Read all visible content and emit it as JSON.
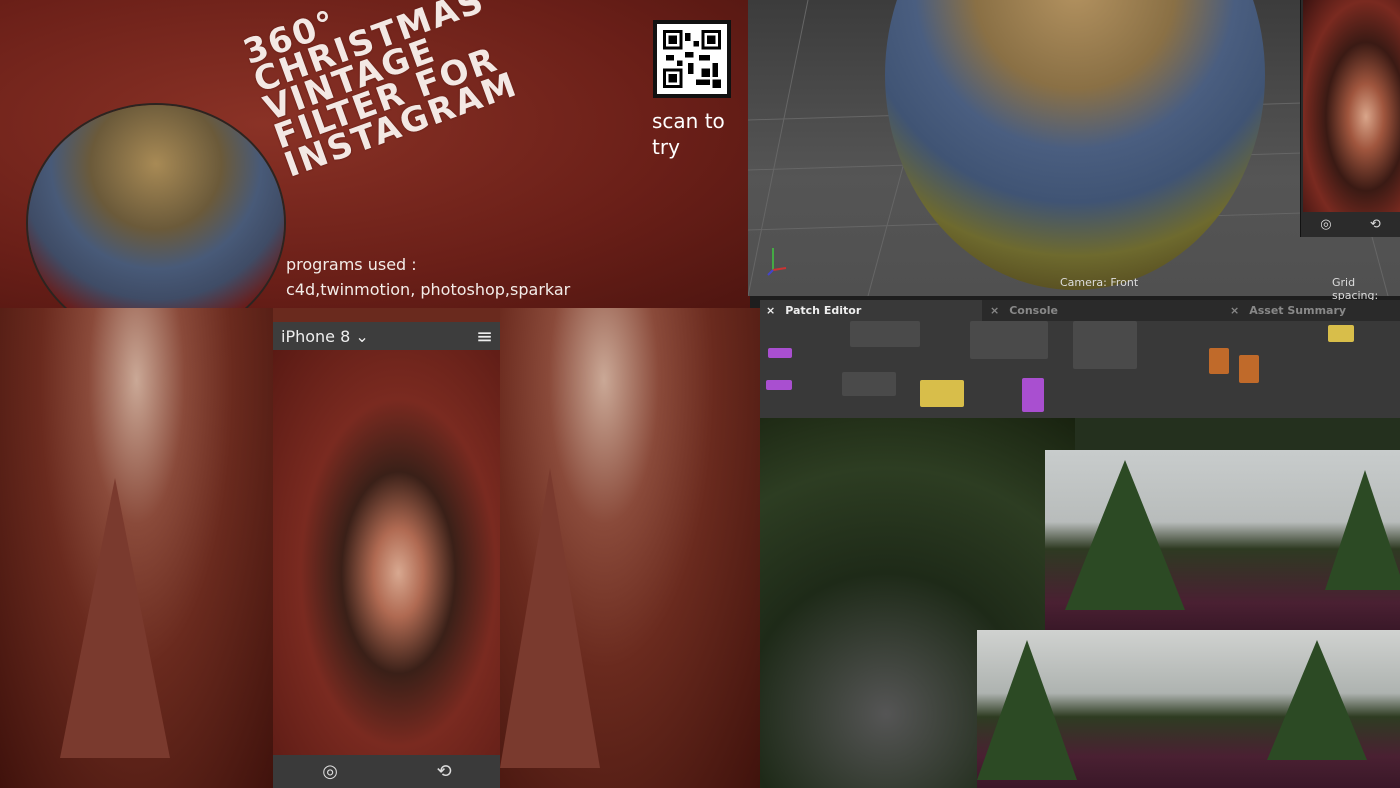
{
  "poster": {
    "title_lines": [
      "360°",
      "CHRISTMAS",
      "VINTAGE",
      "FILTER FOR",
      "INSTAGRAM"
    ],
    "programs_label": "programs used :",
    "programs_list": "c4d,twinmotion, photoshop,sparkar",
    "scan_text": "scan to try"
  },
  "viewport": {
    "camera_label": "Camera: Front",
    "grid_label": "Grid spacing:"
  },
  "patch_editor": {
    "tabs": [
      {
        "label": "Patch Editor",
        "active": true
      },
      {
        "label": "Console",
        "active": false
      },
      {
        "label": "Asset Summary",
        "active": false
      }
    ],
    "close_glyph": "×"
  },
  "phone": {
    "device_label": "iPhone 8",
    "chevron": "⌄",
    "menu": "≡",
    "flip_icon": "⟲",
    "camera_icon": "◎"
  },
  "colors": {
    "poster_bg": "#6a1f18",
    "patch_purple": "#a94fd0",
    "patch_orange": "#c06a2a",
    "patch_yellow": "#d8be4a"
  }
}
